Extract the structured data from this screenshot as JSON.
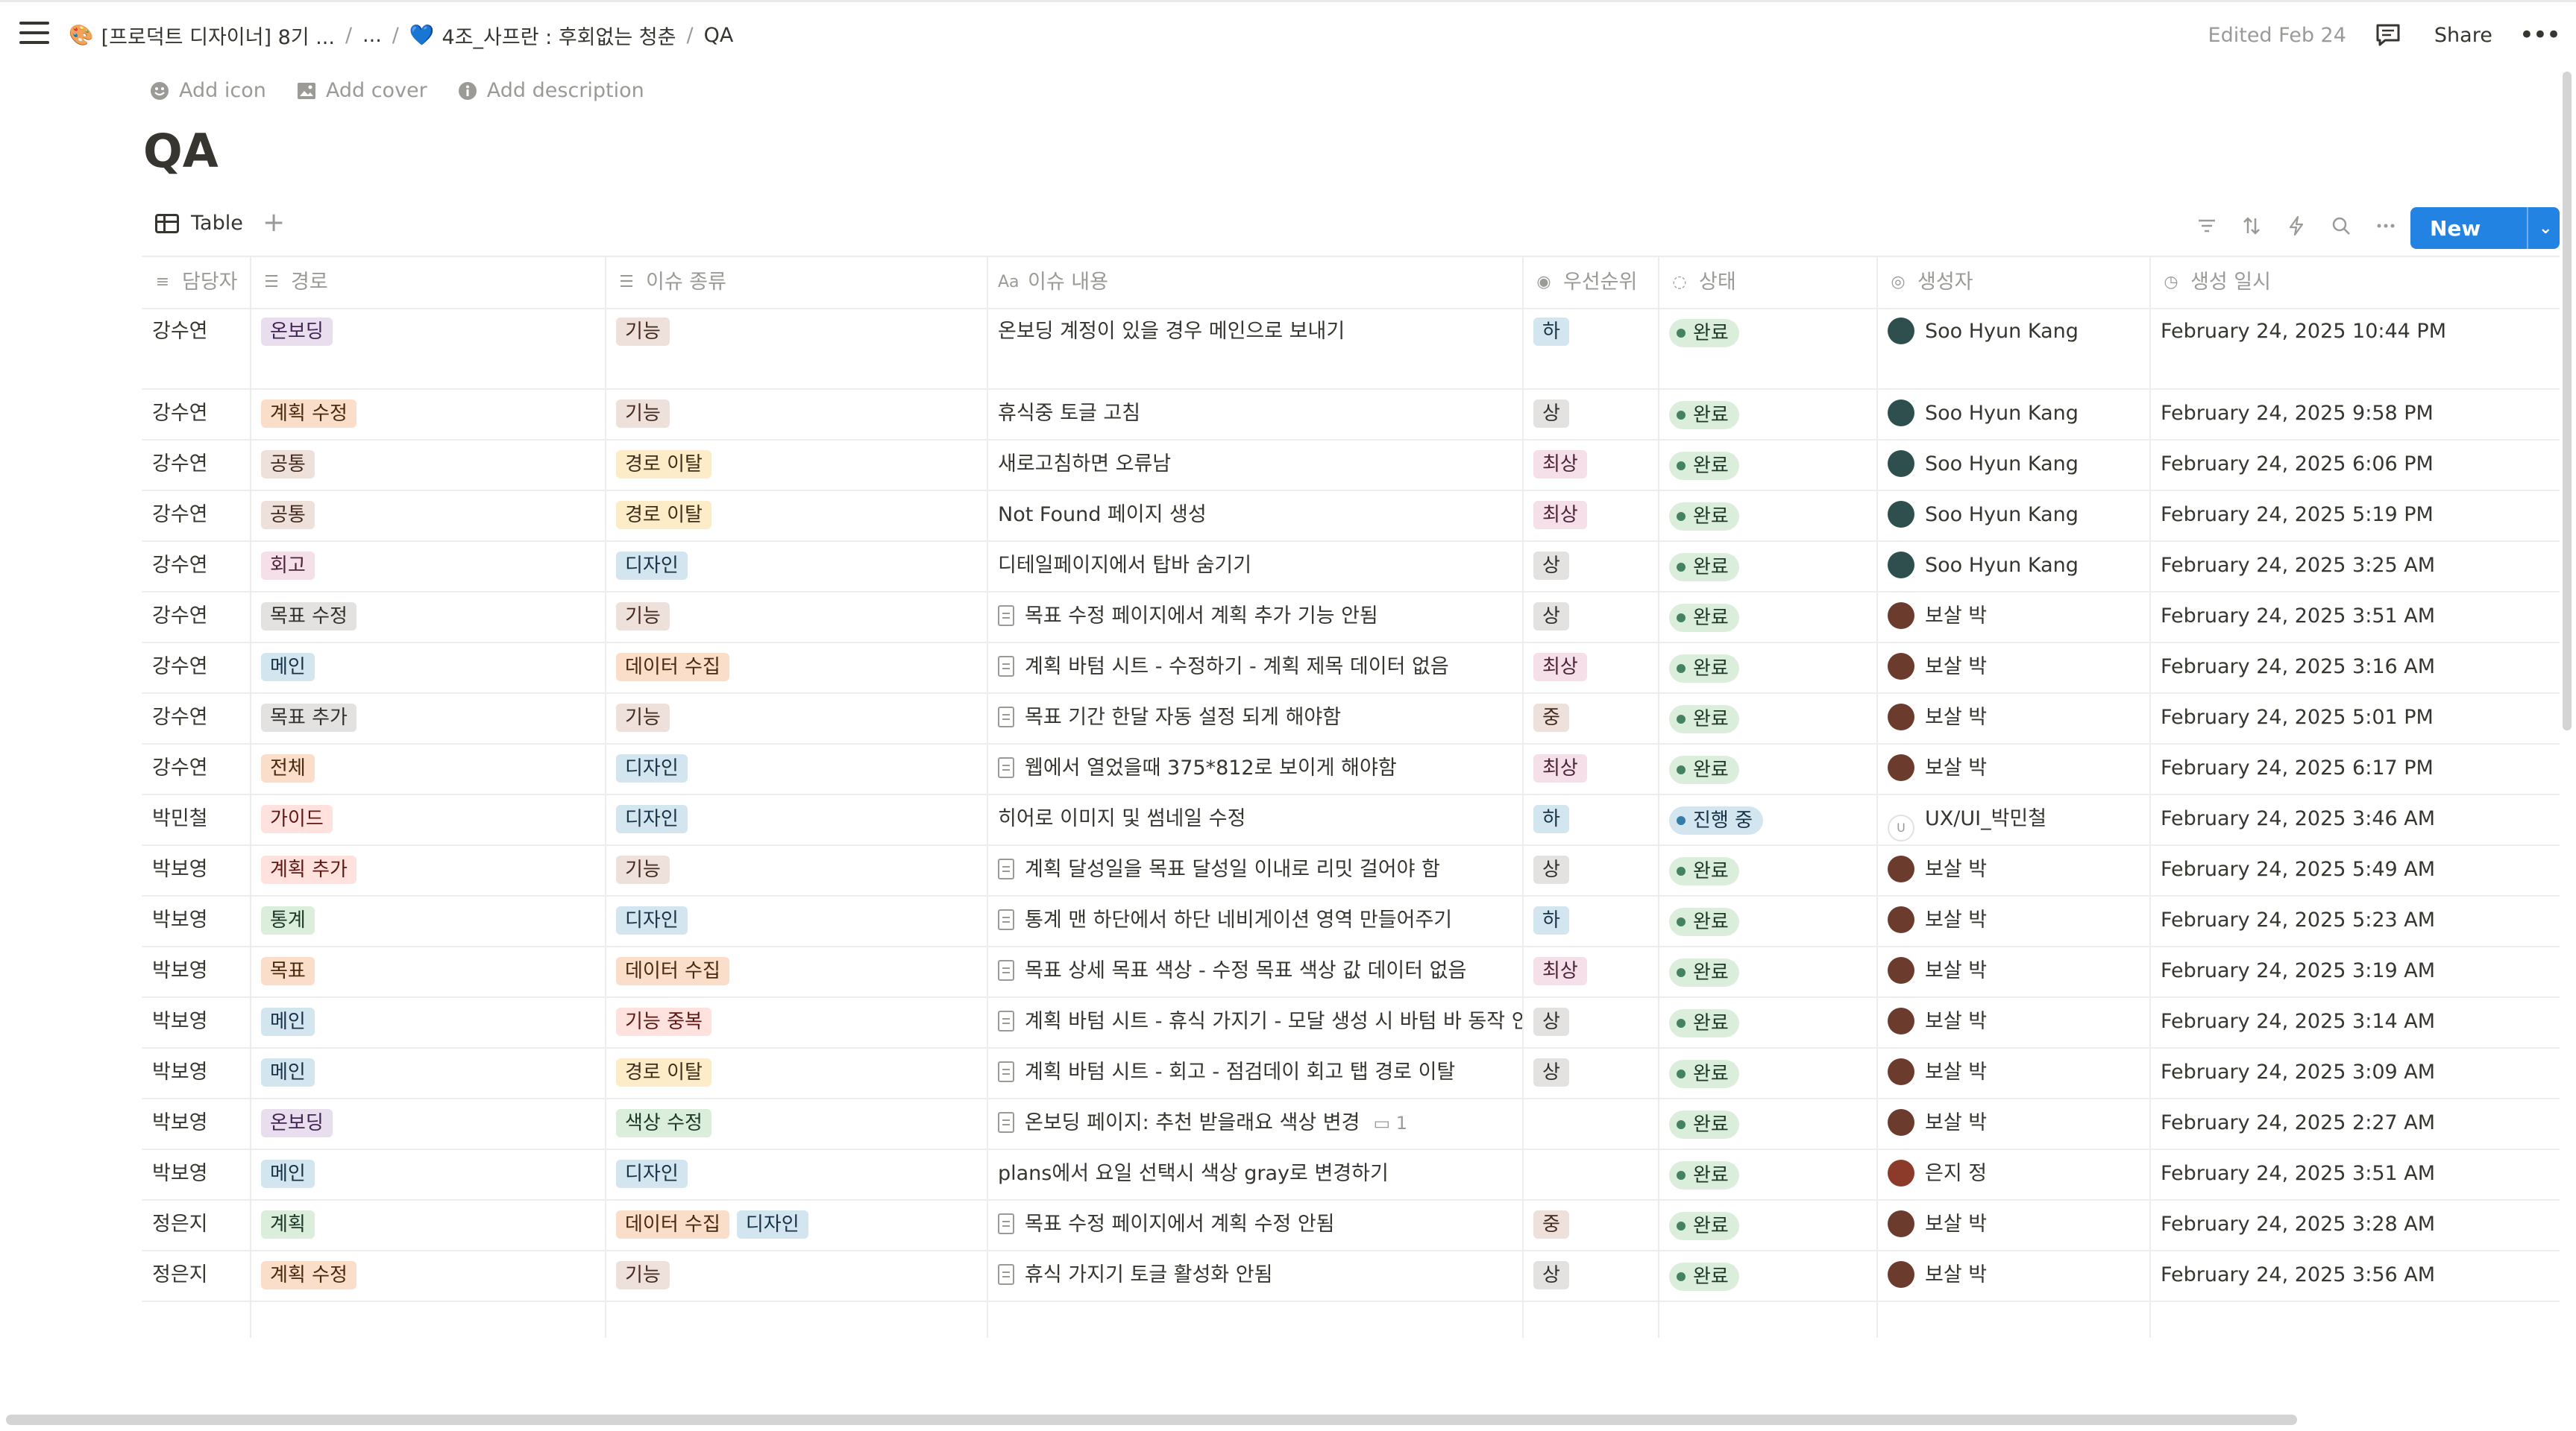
{
  "breadcrumb": {
    "workspace": "[프로덕트 디자이너] 8기 ...",
    "ellipsis": "...",
    "parent": "4조_사프란 : 후회없는 청춘",
    "current": "QA"
  },
  "topbar": {
    "edited": "Edited Feb 24",
    "share": "Share"
  },
  "page": {
    "add_icon": "Add icon",
    "add_cover": "Add cover",
    "add_description": "Add description",
    "title": "QA"
  },
  "view": {
    "tab_label": "Table",
    "new_label": "New"
  },
  "columns": [
    "담당자",
    "경로",
    "이슈 종류",
    "이슈 내용",
    "우선순위",
    "상태",
    "생성자",
    "생성 일시"
  ],
  "rows": [
    {
      "assignee": "강수연",
      "path": [
        {
          "t": "온보딩",
          "c": "purple"
        }
      ],
      "kind": [
        {
          "t": "기능",
          "c": "brown"
        }
      ],
      "issue": "온보딩 계정이 있을 경우 메인으로 보내기",
      "doc": false,
      "comments": "",
      "priority": {
        "t": "하",
        "c": "blue"
      },
      "status": "완료",
      "creator": "Soo Hyun Kang",
      "av": "soo",
      "created": "February 24, 2025 10:44 PM"
    },
    {
      "assignee": "강수연",
      "path": [
        {
          "t": "계획 수정",
          "c": "orange"
        }
      ],
      "kind": [
        {
          "t": "기능",
          "c": "brown"
        }
      ],
      "issue": "휴식중 토글 고침",
      "doc": false,
      "comments": "",
      "priority": {
        "t": "상",
        "c": "gray"
      },
      "status": "완료",
      "creator": "Soo Hyun Kang",
      "av": "soo",
      "created": "February 24, 2025 9:58 PM"
    },
    {
      "assignee": "강수연",
      "path": [
        {
          "t": "공통",
          "c": "brown"
        }
      ],
      "kind": [
        {
          "t": "경로 이탈",
          "c": "yellow"
        }
      ],
      "issue": "새로고침하면 오류남",
      "doc": false,
      "comments": "",
      "priority": {
        "t": "최상",
        "c": "pink"
      },
      "status": "완료",
      "creator": "Soo Hyun Kang",
      "av": "soo",
      "created": "February 24, 2025 6:06 PM"
    },
    {
      "assignee": "강수연",
      "path": [
        {
          "t": "공통",
          "c": "brown"
        }
      ],
      "kind": [
        {
          "t": "경로 이탈",
          "c": "yellow"
        }
      ],
      "issue": "Not Found 페이지 생성",
      "doc": false,
      "comments": "",
      "priority": {
        "t": "최상",
        "c": "pink"
      },
      "status": "완료",
      "creator": "Soo Hyun Kang",
      "av": "soo",
      "created": "February 24, 2025 5:19 PM"
    },
    {
      "assignee": "강수연",
      "path": [
        {
          "t": "회고",
          "c": "pink"
        }
      ],
      "kind": [
        {
          "t": "디자인",
          "c": "blue"
        }
      ],
      "issue": "디테일페이지에서 탑바 숨기기",
      "doc": false,
      "comments": "",
      "priority": {
        "t": "상",
        "c": "gray"
      },
      "status": "완료",
      "creator": "Soo Hyun Kang",
      "av": "soo",
      "created": "February 24, 2025 3:25 AM"
    },
    {
      "assignee": "강수연",
      "path": [
        {
          "t": "목표 수정",
          "c": "gray"
        }
      ],
      "kind": [
        {
          "t": "기능",
          "c": "brown"
        }
      ],
      "issue": "목표 수정 페이지에서 계획 추가 기능 안됨",
      "doc": true,
      "comments": "",
      "priority": {
        "t": "상",
        "c": "gray"
      },
      "status": "완료",
      "creator": "보살 박",
      "av": "bo",
      "created": "February 24, 2025 3:51 AM"
    },
    {
      "assignee": "강수연",
      "path": [
        {
          "t": "메인",
          "c": "blue"
        }
      ],
      "kind": [
        {
          "t": "데이터 수집",
          "c": "orange"
        }
      ],
      "issue": "계획 바텀 시트 - 수정하기 - 계획 제목 데이터 없음",
      "doc": true,
      "comments": "",
      "priority": {
        "t": "최상",
        "c": "pink"
      },
      "status": "완료",
      "creator": "보살 박",
      "av": "bo",
      "created": "February 24, 2025 3:16 AM"
    },
    {
      "assignee": "강수연",
      "path": [
        {
          "t": "목표 추가",
          "c": "gray"
        }
      ],
      "kind": [
        {
          "t": "기능",
          "c": "brown"
        }
      ],
      "issue": "목표 기간 한달 자동 설정 되게 해야함",
      "doc": true,
      "comments": "",
      "priority": {
        "t": "중",
        "c": "brown"
      },
      "status": "완료",
      "creator": "보살 박",
      "av": "bo",
      "created": "February 24, 2025 5:01 PM"
    },
    {
      "assignee": "강수연",
      "path": [
        {
          "t": "전체",
          "c": "orange"
        }
      ],
      "kind": [
        {
          "t": "디자인",
          "c": "blue"
        }
      ],
      "issue": "웹에서 열었을때 375*812로 보이게 해야함",
      "doc": true,
      "comments": "",
      "priority": {
        "t": "최상",
        "c": "pink"
      },
      "status": "완료",
      "creator": "보살 박",
      "av": "bo",
      "created": "February 24, 2025 6:17 PM"
    },
    {
      "assignee": "박민철",
      "path": [
        {
          "t": "가이드",
          "c": "red"
        }
      ],
      "kind": [
        {
          "t": "디자인",
          "c": "blue"
        }
      ],
      "issue": "히어로 이미지 및 썸네일 수정",
      "doc": false,
      "comments": "",
      "priority": {
        "t": "하",
        "c": "blue"
      },
      "status": "진행 중",
      "creator": "UX/UI_박민철",
      "av": "u",
      "created": "February 24, 2025 3:46 AM"
    },
    {
      "assignee": "박보영",
      "path": [
        {
          "t": "계획 추가",
          "c": "red"
        }
      ],
      "kind": [
        {
          "t": "기능",
          "c": "brown"
        }
      ],
      "issue": "계획 달성일을 목표 달성일 이내로 리밋 걸어야 함",
      "doc": true,
      "comments": "",
      "priority": {
        "t": "상",
        "c": "gray"
      },
      "status": "완료",
      "creator": "보살 박",
      "av": "bo",
      "created": "February 24, 2025 5:49 AM"
    },
    {
      "assignee": "박보영",
      "path": [
        {
          "t": "통계",
          "c": "green"
        }
      ],
      "kind": [
        {
          "t": "디자인",
          "c": "blue"
        }
      ],
      "issue": "통계 맨 하단에서 하단 네비게이션 영역 만들어주기",
      "doc": true,
      "comments": "",
      "priority": {
        "t": "하",
        "c": "blue"
      },
      "status": "완료",
      "creator": "보살 박",
      "av": "bo",
      "created": "February 24, 2025 5:23 AM"
    },
    {
      "assignee": "박보영",
      "path": [
        {
          "t": "목표",
          "c": "orange"
        }
      ],
      "kind": [
        {
          "t": "데이터 수집",
          "c": "orange"
        }
      ],
      "issue": "목표 상세 목표 색상 - 수정 목표 색상 값 데이터 없음",
      "doc": true,
      "comments": "",
      "priority": {
        "t": "최상",
        "c": "pink"
      },
      "status": "완료",
      "creator": "보살 박",
      "av": "bo",
      "created": "February 24, 2025 3:19 AM"
    },
    {
      "assignee": "박보영",
      "path": [
        {
          "t": "메인",
          "c": "blue"
        }
      ],
      "kind": [
        {
          "t": "기능 중복",
          "c": "red"
        }
      ],
      "issue": "계획 바텀 시트 - 휴식 가지기 - 모달 생성 시 바텀 바 동작 안되기",
      "doc": true,
      "comments": "",
      "priority": {
        "t": "상",
        "c": "gray"
      },
      "status": "완료",
      "creator": "보살 박",
      "av": "bo",
      "created": "February 24, 2025 3:14 AM"
    },
    {
      "assignee": "박보영",
      "path": [
        {
          "t": "메인",
          "c": "blue"
        }
      ],
      "kind": [
        {
          "t": "경로 이탈",
          "c": "yellow"
        }
      ],
      "issue": "계획 바텀 시트 - 회고 - 점검데이 회고 탭 경로 이탈",
      "doc": true,
      "comments": "",
      "priority": {
        "t": "상",
        "c": "gray"
      },
      "status": "완료",
      "creator": "보살 박",
      "av": "bo",
      "created": "February 24, 2025 3:09 AM"
    },
    {
      "assignee": "박보영",
      "path": [
        {
          "t": "온보딩",
          "c": "purple"
        }
      ],
      "kind": [
        {
          "t": "색상 수정",
          "c": "green"
        }
      ],
      "issue": "온보딩 페이지: 추천 받을래요 색상 변경",
      "doc": true,
      "comments": "1",
      "priority": null,
      "status": "완료",
      "creator": "보살 박",
      "av": "bo",
      "created": "February 24, 2025 2:27 AM"
    },
    {
      "assignee": "박보영",
      "path": [
        {
          "t": "메인",
          "c": "blue"
        }
      ],
      "kind": [
        {
          "t": "디자인",
          "c": "blue"
        }
      ],
      "issue": "plans에서 요일 선택시 색상 gray로 변경하기",
      "doc": false,
      "comments": "",
      "priority": null,
      "status": "완료",
      "creator": "은지 정",
      "av": "eun",
      "created": "February 24, 2025 3:51 AM"
    },
    {
      "assignee": "정은지",
      "path": [
        {
          "t": "계획",
          "c": "green"
        }
      ],
      "kind": [
        {
          "t": "데이터 수집",
          "c": "orange"
        },
        {
          "t": "디자인",
          "c": "blue"
        }
      ],
      "issue": "목표 수정 페이지에서 계획 수정 안됨",
      "doc": true,
      "comments": "",
      "priority": {
        "t": "중",
        "c": "brown"
      },
      "status": "완료",
      "creator": "보살 박",
      "av": "bo",
      "created": "February 24, 2025 3:28 AM"
    },
    {
      "assignee": "정은지",
      "path": [
        {
          "t": "계획 수정",
          "c": "orange"
        }
      ],
      "kind": [
        {
          "t": "기능",
          "c": "brown"
        }
      ],
      "issue": "휴식 가지기 토글 활성화 안됨",
      "doc": true,
      "comments": "",
      "priority": {
        "t": "상",
        "c": "gray"
      },
      "status": "완료",
      "creator": "보살 박",
      "av": "bo",
      "created": "February 24, 2025 3:56 AM"
    }
  ]
}
